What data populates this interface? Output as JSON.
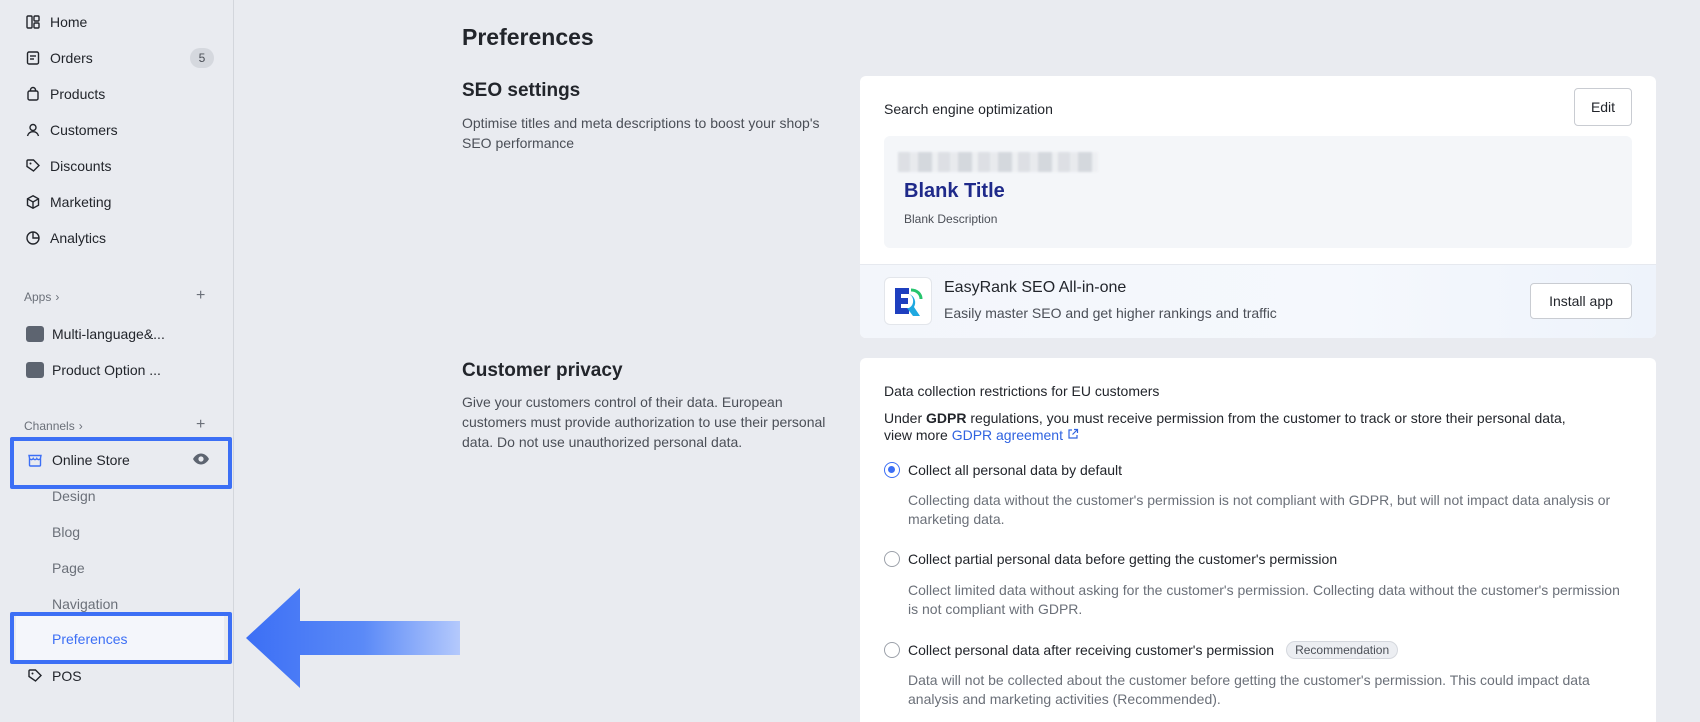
{
  "sidebar": {
    "items": [
      {
        "label": "Home",
        "icon": "home-icon"
      },
      {
        "label": "Orders",
        "icon": "orders-icon",
        "badge": "5"
      },
      {
        "label": "Products",
        "icon": "bag-icon"
      },
      {
        "label": "Customers",
        "icon": "person-icon"
      },
      {
        "label": "Discounts",
        "icon": "tag-icon"
      },
      {
        "label": "Marketing",
        "icon": "cube-icon"
      },
      {
        "label": "Analytics",
        "icon": "chart-icon"
      }
    ],
    "apps_label": "Apps",
    "apps": [
      {
        "label": "Multi-language&..."
      },
      {
        "label": "Product Option ..."
      }
    ],
    "channels_label": "Channels",
    "online_store": "Online Store",
    "sub_items": [
      "Design",
      "Blog",
      "Page",
      "Navigation",
      "Preferences"
    ],
    "pos": "POS"
  },
  "main": {
    "title": "Preferences",
    "seo": {
      "title": "SEO settings",
      "desc": "Optimise titles and meta descriptions to boost your shop's SEO performance",
      "card_label": "Search engine optimization",
      "edit": "Edit",
      "preview_title": "Blank Title",
      "preview_desc": "Blank Description",
      "promo_title": "EasyRank SEO All-in-one",
      "promo_desc": "Easily master SEO and get higher rankings and traffic",
      "install": "Install app"
    },
    "privacy": {
      "title": "Customer privacy",
      "desc": "Give your customers control of their data. European customers must provide authorization to use their personal data. Do not use unauthorized personal data.",
      "card_label": "Data collection restrictions for EU customers",
      "gdpr_pre": "Under ",
      "gdpr_bold": "GDPR",
      "gdpr_post": " regulations, you must receive permission from the customer to track or store their personal data,",
      "view_more": "view more ",
      "gdpr_link": "GDPR agreement",
      "options": [
        {
          "label": "Collect all personal data by default",
          "desc": "Collecting data without the customer's permission is not compliant with GDPR, but will not impact data analysis or marketing data."
        },
        {
          "label": "Collect partial personal data before getting the customer's permission",
          "desc": "Collect limited data without asking for the customer's permission. Collecting data without the customer's permission is not compliant with GDPR."
        },
        {
          "label": "Collect personal data after receiving customer's permission",
          "badge": "Recommendation",
          "desc": "Data will not be collected about the customer before getting the customer's permission. This could impact data analysis and marketing activities (Recommended)."
        }
      ]
    }
  },
  "colors": {
    "accent": "#3c6ff5",
    "link": "#2f63e0",
    "preview_title": "#1f2a8a"
  }
}
